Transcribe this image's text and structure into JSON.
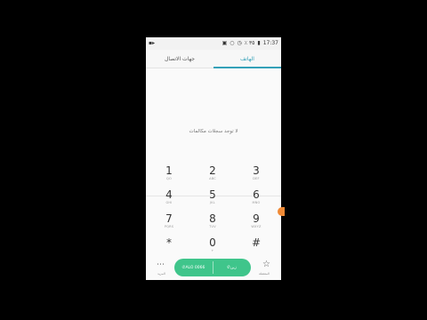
{
  "status_bar": {
    "camera_icon": "video-icon",
    "carrier_text": "٪ ٣٥",
    "time": "17:37"
  },
  "tabs": [
    {
      "label": "جهات الاتصال"
    },
    {
      "label": "الهاتف"
    }
  ],
  "call_log": {
    "empty_text": "لا توجد سجلات مكالمات"
  },
  "keypad": [
    {
      "digit": "1",
      "letters": "QO"
    },
    {
      "digit": "2",
      "letters": "ABC"
    },
    {
      "digit": "3",
      "letters": "DEF"
    },
    {
      "digit": "4",
      "letters": "GHI"
    },
    {
      "digit": "5",
      "letters": "JKL"
    },
    {
      "digit": "6",
      "letters": "MNO"
    },
    {
      "digit": "7",
      "letters": "PQRS"
    },
    {
      "digit": "8",
      "letters": "TUV"
    },
    {
      "digit": "9",
      "letters": "WXYZ"
    },
    {
      "digit": "*",
      "letters": ""
    },
    {
      "digit": "0",
      "letters": "+"
    },
    {
      "digit": "#",
      "letters": ""
    }
  ],
  "bottom_bar": {
    "more_label": "المزيد",
    "call_sim1": "ALO 0066",
    "call_sim2": "زين",
    "favorites_label": "المفضلة"
  }
}
